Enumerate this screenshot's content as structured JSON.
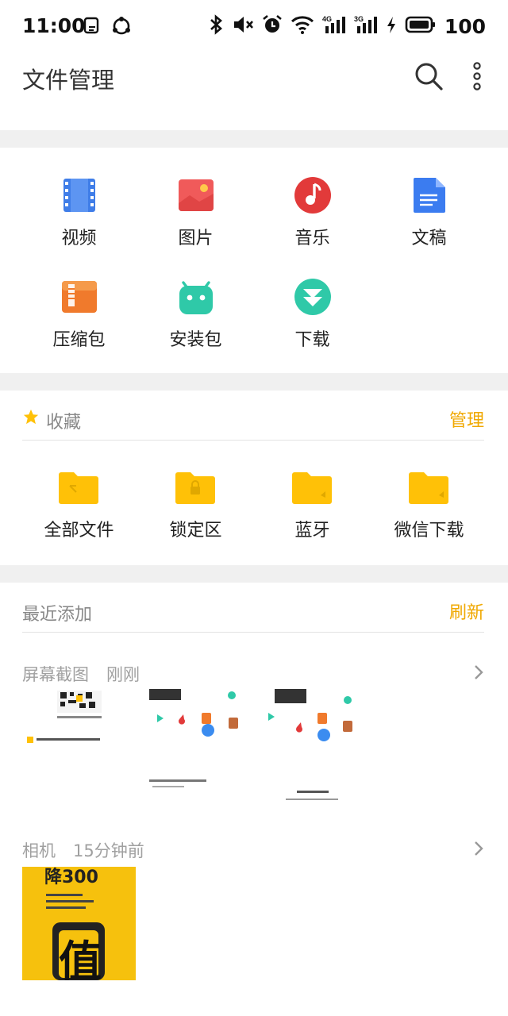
{
  "status": {
    "time": "11:00",
    "network1": "4G",
    "network2": "3G",
    "battery": "100"
  },
  "header": {
    "title": "文件管理",
    "search_icon": "search-icon",
    "more_icon": "more-vertical-icon"
  },
  "categories": [
    {
      "label": "视频",
      "icon": "video-icon",
      "color": "#3f7de8"
    },
    {
      "label": "图片",
      "icon": "image-icon",
      "color": "#f05a5a"
    },
    {
      "label": "音乐",
      "icon": "music-icon",
      "color": "#e23a3a"
    },
    {
      "label": "文稿",
      "icon": "document-icon",
      "color": "#3b7cf0"
    },
    {
      "label": "压缩包",
      "icon": "archive-icon",
      "color": "#f07a2c"
    },
    {
      "label": "安装包",
      "icon": "android-icon",
      "color": "#2fc9a8"
    },
    {
      "label": "下载",
      "icon": "download-icon",
      "color": "#2fc9a8"
    }
  ],
  "favorites": {
    "title": "收藏",
    "action": "管理",
    "items": [
      {
        "label": "全部文件",
        "icon": "folder-icon"
      },
      {
        "label": "锁定区",
        "icon": "locked-folder-icon"
      },
      {
        "label": "蓝牙",
        "icon": "bluetooth-folder-icon"
      },
      {
        "label": "微信下载",
        "icon": "wechat-folder-icon"
      }
    ]
  },
  "recent": {
    "title": "最近添加",
    "action": "刷新",
    "groups": [
      {
        "name": "屏幕截图",
        "time": "刚刚"
      },
      {
        "name": "相机",
        "time": "15分钟前"
      }
    ],
    "thumb_text": "降300",
    "thumb_char": "值"
  },
  "colors": {
    "accent": "#f0a800",
    "folder": "#ffc107",
    "divider": "#f0f0f0"
  }
}
